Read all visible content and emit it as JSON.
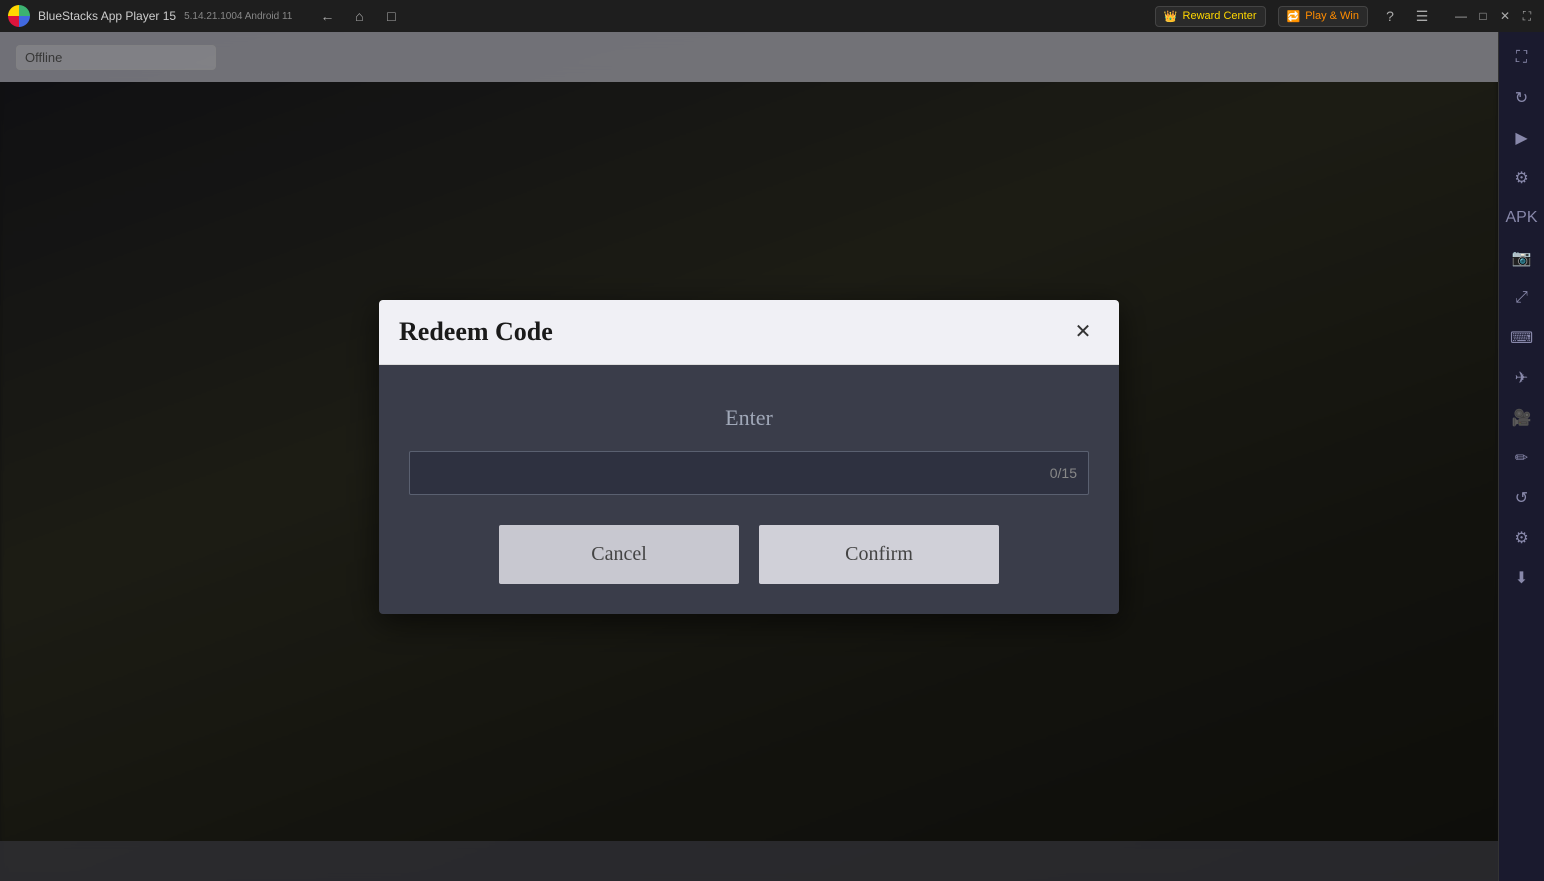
{
  "titlebar": {
    "app_name": "BlueStacks App Player 15",
    "version": "5.14.21.1004  Android 11",
    "reward_center_label": "Reward Center",
    "play_win_label": "Play & Win"
  },
  "window_controls": {
    "minimize": "—",
    "maximize": "□",
    "close": "✕",
    "expand": "⛶"
  },
  "sidebar": {
    "icons": [
      {
        "name": "expand-icon",
        "symbol": "⛶"
      },
      {
        "name": "sync-icon",
        "symbol": "↻"
      },
      {
        "name": "play-icon",
        "symbol": "▶"
      },
      {
        "name": "settings-icon",
        "symbol": "⚙"
      },
      {
        "name": "layout-icon",
        "symbol": "▦"
      },
      {
        "name": "screenshot-icon",
        "symbol": "⬜"
      },
      {
        "name": "resize-icon",
        "symbol": "⤢"
      },
      {
        "name": "keyboard-icon",
        "symbol": "⌨"
      },
      {
        "name": "location-icon",
        "symbol": "✈"
      },
      {
        "name": "camera-icon",
        "symbol": "📷"
      },
      {
        "name": "brush-icon",
        "symbol": "✏"
      },
      {
        "name": "refresh-icon",
        "symbol": "↺"
      },
      {
        "name": "gear-icon",
        "symbol": "⚙"
      },
      {
        "name": "download-icon",
        "symbol": "⬇"
      }
    ]
  },
  "dialog": {
    "title": "Redeem Code",
    "close_label": "✕",
    "enter_label": "Enter",
    "input_placeholder": "",
    "input_counter": "0/15",
    "cancel_label": "Cancel",
    "confirm_label": "Confirm"
  }
}
